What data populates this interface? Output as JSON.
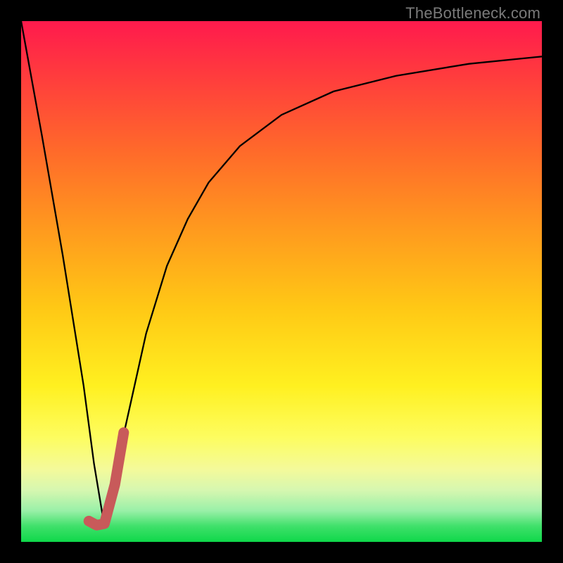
{
  "credit_text": "TheBottleneck.com",
  "series_line_name": "bottleneck-curve",
  "series_hook_name": "j-hook-marker",
  "chart_data": {
    "type": "line",
    "title": "",
    "xlabel": "",
    "ylabel": "",
    "xlim": [
      0,
      100
    ],
    "ylim": [
      0,
      100
    ],
    "grid": false,
    "series": [
      {
        "name": "bottleneck-curve",
        "x": [
          0,
          4,
          8,
          12,
          14,
          16,
          18,
          20,
          24,
          28,
          32,
          36,
          42,
          50,
          60,
          72,
          86,
          100
        ],
        "values": [
          100,
          78,
          55,
          30,
          15,
          3,
          10,
          22,
          40,
          53,
          62,
          69,
          76,
          82,
          86.5,
          89.5,
          91.8,
          93.2
        ]
      },
      {
        "name": "j-hook-marker",
        "x": [
          13.0,
          14.5,
          16.0,
          18.0,
          19.7
        ],
        "values": [
          4.0,
          3.2,
          3.5,
          11.0,
          21.0
        ]
      }
    ],
    "colors": {
      "gradient_top": "#ff1a4d",
      "gradient_bottom": "#0fd84a",
      "curve": "#000000",
      "hook": "#c85a5a",
      "frame": "#000000"
    }
  }
}
